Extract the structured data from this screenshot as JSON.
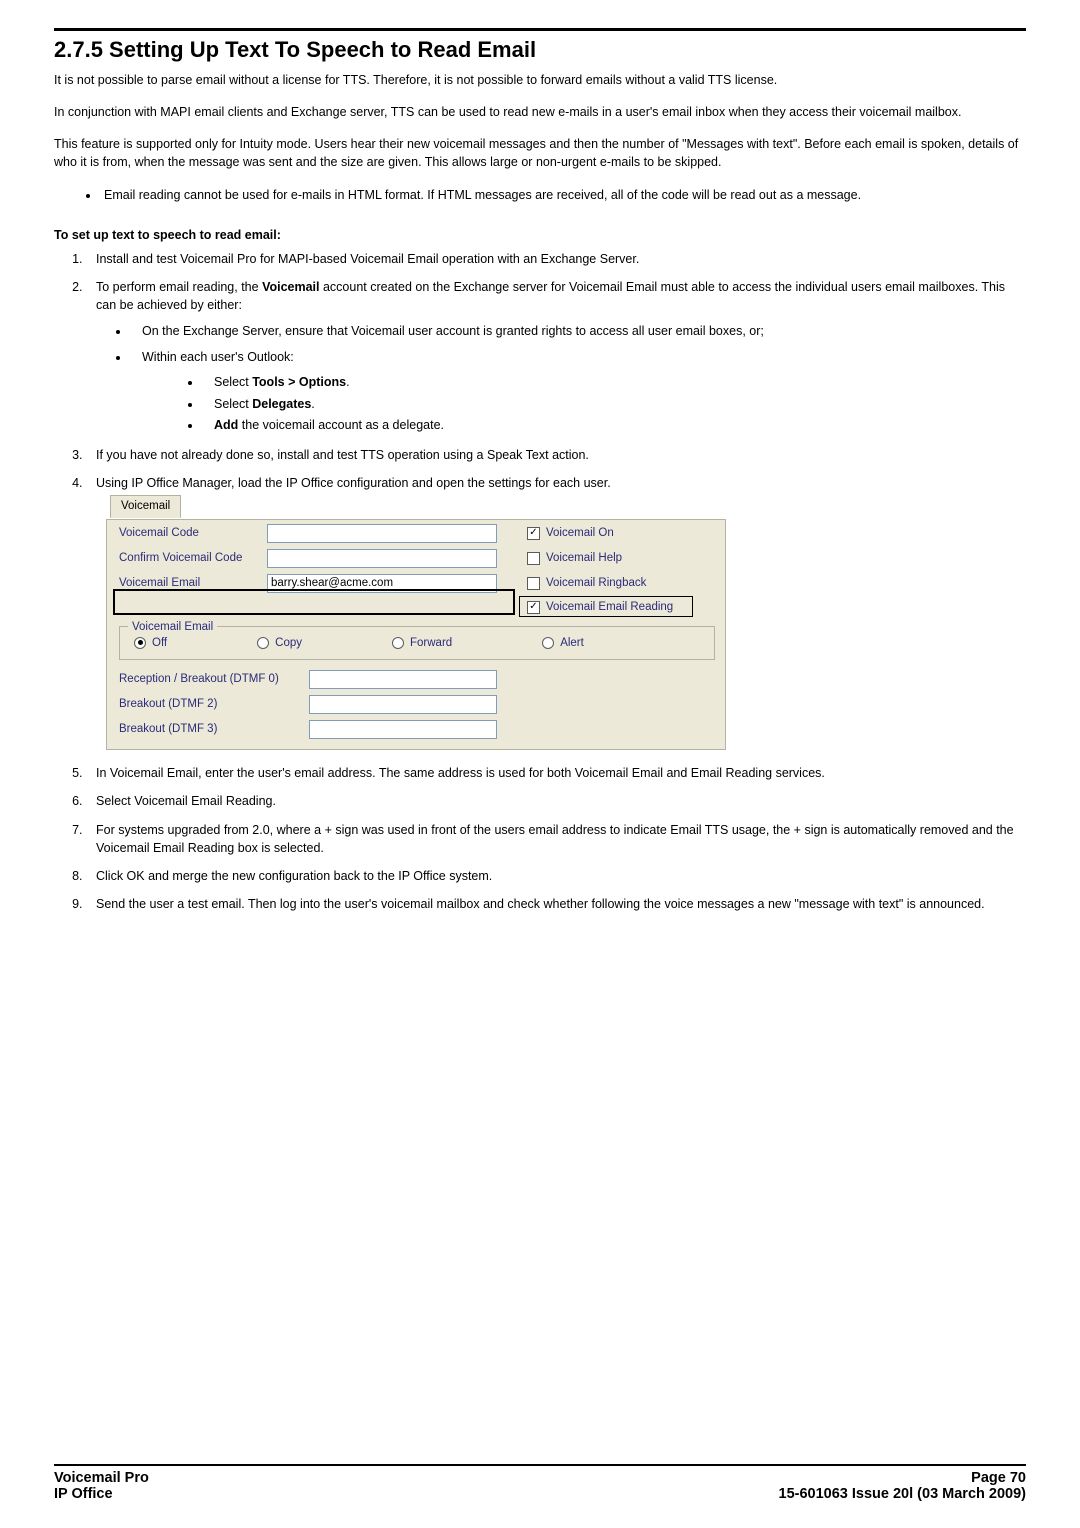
{
  "title": "2.7.5 Setting Up Text To Speech to Read Email",
  "p1": "It is not possible to parse email without a license for TTS. Therefore, it is not possible to forward emails without a valid TTS license.",
  "p2": "In conjunction with MAPI email clients and Exchange server, TTS can be used to read new e-mails in a user's email inbox when they access their voicemail mailbox.",
  "p3": "This feature is supported only for Intuity mode. Users hear their new voicemail messages and then the number of \"Messages with text\". Before each email is spoken, details of who it is from, when the message was sent and the size are given. This allows large or non-urgent e-mails to be skipped.",
  "bullet1": "Email reading cannot be used for e-mails in HTML format. If HTML messages are received, all of the code will be read out as a message.",
  "subhead": "To set up text to speech to read email:",
  "step1": "Install and test Voicemail Pro for MAPI-based Voicemail Email operation with an Exchange Server.",
  "step2_a": "To perform email reading, the ",
  "step2_b": "Voicemail",
  "step2_c": " account created on the Exchange server for Voicemail Email must able to access the individual users email mailboxes. This can be achieved by either:",
  "step2_s1": "On the Exchange Server, ensure that Voicemail user account is granted rights to access all user email boxes, or;",
  "step2_s2": "Within each user's Outlook:",
  "step2_s2_a_pre": "Select ",
  "step2_s2_a_b": "Tools > Options",
  "step2_s2_a_post": ".",
  "step2_s2_b_pre": "Select ",
  "step2_s2_b_b": "Delegates",
  "step2_s2_b_post": ".",
  "step2_s2_c_b": "Add",
  "step2_s2_c_post": " the voicemail account as a delegate.",
  "step3": "If you have not already done so, install and test TTS operation using a  Speak Text action.",
  "step4": "Using IP Office Manager, load the IP Office configuration and open the settings for each user.",
  "dlg": {
    "tab": "Voicemail",
    "vm_code": "Voicemail Code",
    "confirm": "Confirm Voicemail Code",
    "vm_email": "Voicemail Email",
    "email_value": "barry.shear@acme.com",
    "vm_on": "Voicemail On",
    "vm_help": "Voicemail Help",
    "vm_ring": "Voicemail Ringback",
    "vm_er": "Voicemail Email Reading",
    "grp": "Voicemail Email",
    "off": "Off",
    "copy": "Copy",
    "forward": "Forward",
    "alert": "Alert",
    "recep": "Reception / Breakout (DTMF 0)",
    "b2": "Breakout (DTMF 2)",
    "b3": "Breakout (DTMF 3)"
  },
  "step5": "In Voicemail Email, enter the user's email address. The same address is used for both Voicemail Email and Email Reading services.",
  "step6": "Select Voicemail Email Reading.",
  "step7": "For systems upgraded from 2.0, where a + sign was used in front of the users email address to indicate Email TTS usage, the + sign is automatically removed and the Voicemail Email Reading box is selected.",
  "step8": "Click OK and merge the new configuration back to the IP Office system.",
  "step9": "Send the user a test email. Then log into the user's voicemail mailbox and check whether following the voice messages a new \"message with text\" is announced.",
  "footer": {
    "left1": "Voicemail Pro",
    "left2": "IP Office",
    "right1": "Page 70",
    "right2": "15-601063 Issue 20l (03 March 2009)"
  }
}
